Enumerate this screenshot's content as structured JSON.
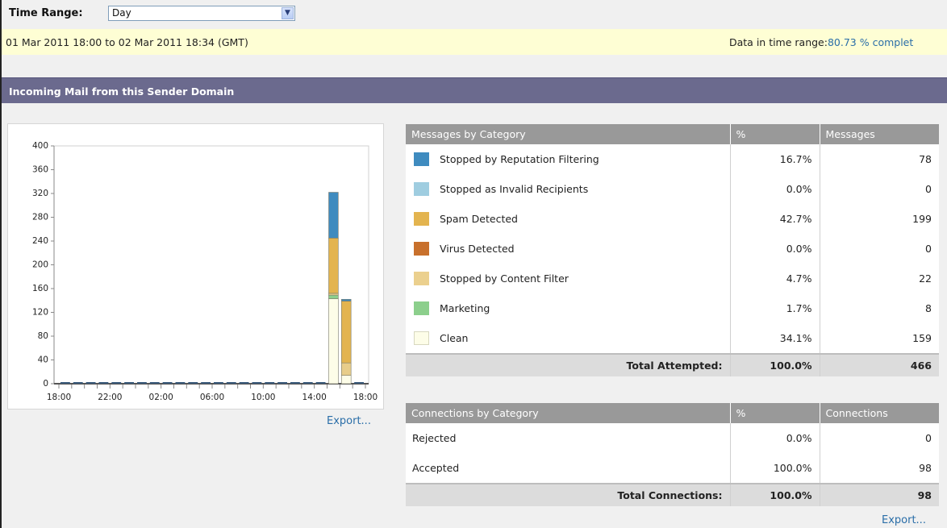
{
  "time_range": {
    "label": "Time Range:",
    "selected": "Day"
  },
  "info": {
    "range_text": "01 Mar 2011 18:00 to 02 Mar 2011 18:34 (GMT)",
    "data_label": "Data in time range:",
    "data_value": "80.73 % complet"
  },
  "section": {
    "title": "Incoming Mail from this Sender Domain"
  },
  "chart_data": {
    "type": "bar",
    "stacked": true,
    "yticks": [
      "400",
      "360",
      "320",
      "280",
      "240",
      "200",
      "160",
      "120",
      "80",
      "40",
      "0"
    ],
    "xticks": [
      "18:00",
      "22:00",
      "02:00",
      "06:00",
      "10:00",
      "14:00",
      "18:00"
    ],
    "ylim": [
      0,
      400
    ],
    "series_colors": {
      "clean": "#fdfde8",
      "marketing": "#8ccf8c",
      "content_filter": "#e8cd8a",
      "spam": "#e3b44f",
      "reputation": "#3f8bbf"
    },
    "bars": [
      {
        "hour": "15:00",
        "clean": 143,
        "marketing": 6,
        "content_filter": 3,
        "spam": 93,
        "reputation": 77
      },
      {
        "hour": "16:00",
        "clean": 14,
        "marketing": 0,
        "content_filter": 21,
        "spam": 104,
        "reputation": 3
      }
    ]
  },
  "chart_export": "Export...",
  "messages": {
    "headers": [
      "Messages by Category",
      "%",
      "Messages"
    ],
    "rows": [
      {
        "color": "#3f8bbf",
        "label": "Stopped by Reputation Filtering",
        "pct": "16.7%",
        "count": "78"
      },
      {
        "color": "#9fcde0",
        "label": "Stopped as Invalid Recipients",
        "pct": "0.0%",
        "count": "0"
      },
      {
        "color": "#e3b44f",
        "label": "Spam Detected",
        "pct": "42.7%",
        "count": "199"
      },
      {
        "color": "#c8702c",
        "label": "Virus Detected",
        "pct": "0.0%",
        "count": "0"
      },
      {
        "color": "#ebd08e",
        "label": "Stopped by Content Filter",
        "pct": "4.7%",
        "count": "22"
      },
      {
        "color": "#8ccf8c",
        "label": "Marketing",
        "pct": "1.7%",
        "count": "8"
      },
      {
        "color": "#fdfde8",
        "label": "Clean",
        "pct": "34.1%",
        "count": "159"
      }
    ],
    "total": {
      "label": "Total Attempted:",
      "pct": "100.0%",
      "count": "466"
    }
  },
  "connections": {
    "headers": [
      "Connections by Category",
      "%",
      "Connections"
    ],
    "rows": [
      {
        "label": "Rejected",
        "pct": "0.0%",
        "count": "0"
      },
      {
        "label": "Accepted",
        "pct": "100.0%",
        "count": "98"
      }
    ],
    "total": {
      "label": "Total Connections:",
      "pct": "100.0%",
      "count": "98"
    }
  },
  "table_export": "Export..."
}
